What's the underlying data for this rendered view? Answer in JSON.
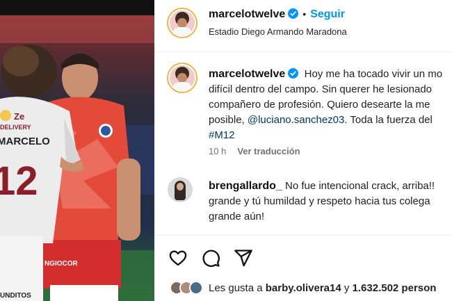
{
  "post": {
    "username": "marcelotwelve",
    "follow_label": "Seguir",
    "separator": "•",
    "location": "Estadio Diego Armando Maradona",
    "caption": {
      "line1": "Hoy me ha tocado vivir un mo",
      "line2": "difícil dentro del campo. Sin querer he lesionado",
      "line3": "compañero de profesión. Quiero desearte la me",
      "line4_pre": "posible, ",
      "mention": "@luciano.sanchez03",
      "line4_post": ". Toda la fuerza del",
      "hashtag": "#M12"
    },
    "time": "10 h",
    "translate": "Ver traducción",
    "comment": {
      "username": "brengallardo_",
      "line1": " No fue intencional crack, arriba!!",
      "line2": "grande y tú humildad y respeto hacia tus colega",
      "line3": "grande aún!"
    },
    "likes": {
      "prefix": "Les gusta a ",
      "user": "barby.olivera14",
      "middle": " y ",
      "count": "1.632.502",
      "suffix": " person"
    }
  },
  "photo": {
    "jersey_logo": "Ze",
    "jersey_sub": "DELIVERY",
    "jersey_name": "MARCELO",
    "jersey_number": "12",
    "short_text": "UNDITOS",
    "red_short_text": "NGIOCOR"
  },
  "icons": {
    "like": "heart-icon",
    "comment": "comment-icon",
    "share": "share-icon",
    "verified": "verified-badge-icon"
  },
  "colors": {
    "accent": "#0095f6",
    "verified": "#0095f6",
    "link": "#00376b",
    "muted": "#737373"
  }
}
